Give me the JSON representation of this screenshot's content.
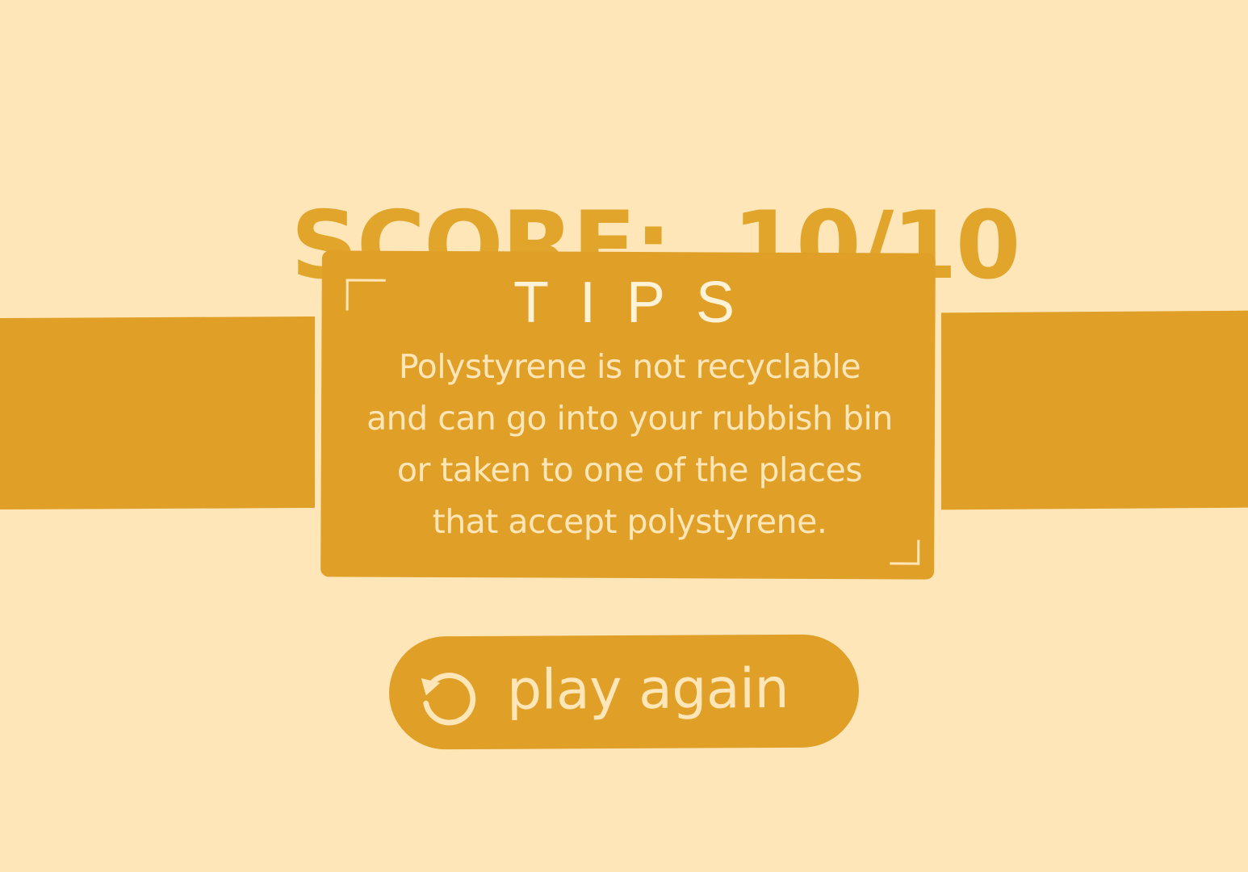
{
  "score": {
    "label": "SCORE:",
    "value": "10/10",
    "display": "SCORE:  10/10"
  },
  "tips": {
    "title": "TIPS",
    "lines": [
      "Polystyrene is not recyclable",
      "and can go into your rubbish bin",
      "or taken to one of the places",
      "that accept polystyrene."
    ]
  },
  "actions": {
    "play_again_label": "play again",
    "play_again_icon": "replay-icon"
  },
  "colors": {
    "background": "#FFE6B8",
    "accent": "#E0A028",
    "text_light": "#FFE6B8"
  }
}
